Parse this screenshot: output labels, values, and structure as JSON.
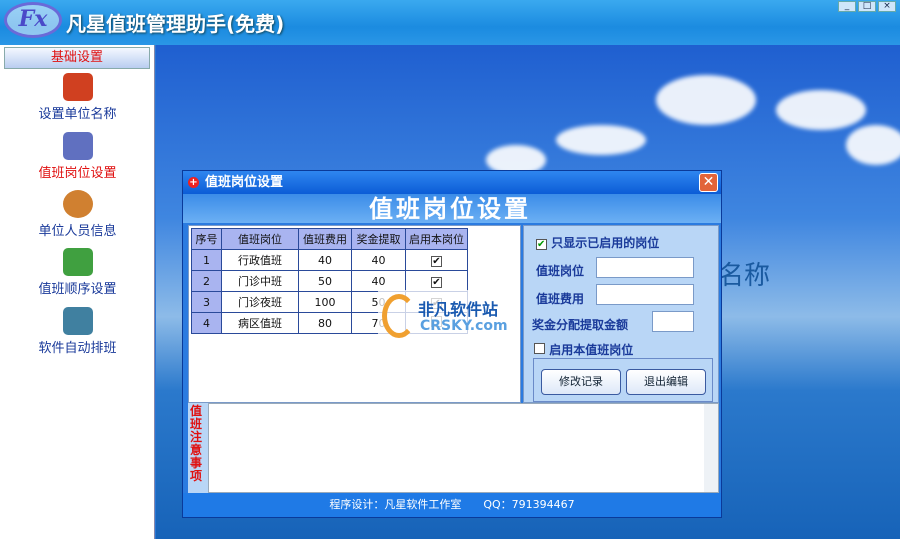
{
  "app": {
    "logo": "Fx",
    "title": "凡星值班管理助手(免费)",
    "controls": [
      "_",
      "□",
      "×"
    ]
  },
  "sidebar": {
    "header": "基础设置",
    "items": [
      {
        "label": "设置单位名称",
        "icon": "house-icon",
        "color": "#d04020"
      },
      {
        "label": "值班岗位设置",
        "icon": "building-icon",
        "color": "#6070c0"
      },
      {
        "label": "单位人员信息",
        "icon": "users-icon",
        "color": "#d08030"
      },
      {
        "label": "值班顺序设置",
        "icon": "money-icon",
        "color": "#40a040"
      },
      {
        "label": "软件自动排班",
        "icon": "server-icon",
        "color": "#4080a0"
      }
    ]
  },
  "background": {
    "text": "名称"
  },
  "dialog": {
    "title": "值班岗位设置",
    "header": "值班岗位设置",
    "table": {
      "columns": [
        "序号",
        "值班岗位",
        "值班费用",
        "奖金提取",
        "启用本岗位"
      ],
      "rows": [
        [
          "1",
          "行政值班",
          "40",
          "40",
          "✔"
        ],
        [
          "2",
          "门诊中班",
          "50",
          "40",
          "✔"
        ],
        [
          "3",
          "门诊夜班",
          "100",
          "50",
          "✔"
        ],
        [
          "4",
          "病区值班",
          "80",
          "70",
          ""
        ]
      ]
    },
    "panel": {
      "only_enabled": "只显示已启用的岗位",
      "only_enabled_checked": "✔",
      "post_label": "值班岗位",
      "post_value": "",
      "fee_label": "值班费用",
      "fee_value": "",
      "bonus_label": "奖金分配提取金额",
      "bonus_value": "",
      "enable_label": "启用本值班岗位",
      "modify_btn": "修改记录",
      "exit_btn": "退出编辑"
    },
    "notes_label": "值班注意事项",
    "footer": "程序设计：凡星软件工作室　　QQ：791394467"
  },
  "watermark": {
    "cn": "非凡软件站",
    "en": "CRSKY.com"
  }
}
